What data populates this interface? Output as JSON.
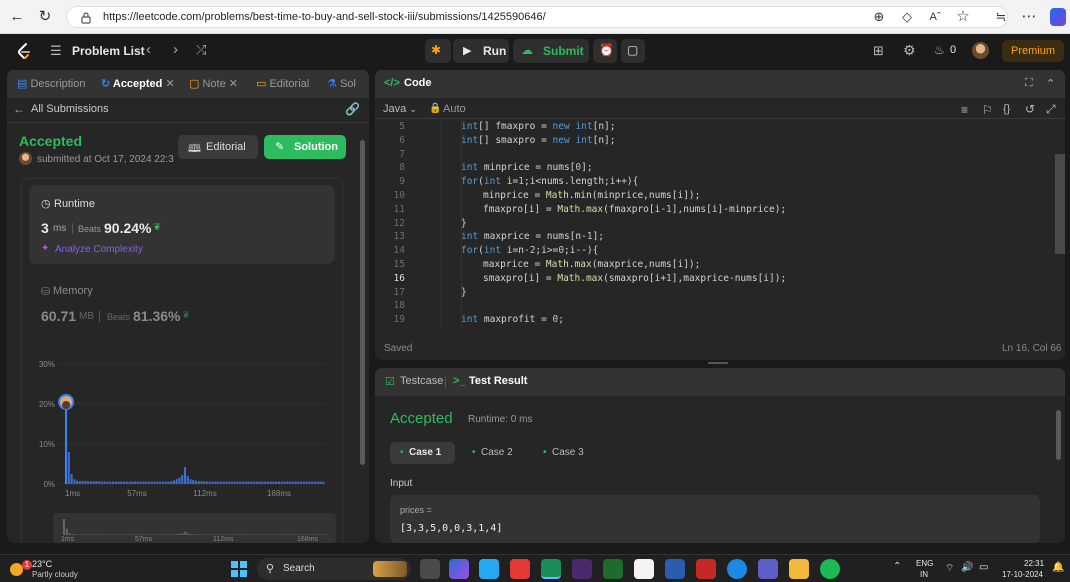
{
  "browser": {
    "url": "https://leetcode.com/problems/best-time-to-buy-and-sell-stock-iii/submissions/1425590646/",
    "reader_label": "Aˆ"
  },
  "topbar": {
    "problem_list": "Problem List",
    "run": "Run",
    "submit": "Submit",
    "streak": "0",
    "premium": "Premium"
  },
  "left": {
    "tabs": [
      "Description",
      "Accepted",
      "Note",
      "Editorial",
      "Sol"
    ],
    "all_submissions": "All Submissions",
    "status": "Accepted",
    "submitted": "submitted at Oct 17, 2024 22:3",
    "editorial_btn": "Editorial",
    "solution_btn": "Solution",
    "runtime_label": "Runtime",
    "runtime_value": "3",
    "runtime_unit": "ms",
    "beats_label": "Beats",
    "runtime_beats": "90.24%",
    "analyze": "Analyze Complexity",
    "memory_label": "Memory",
    "memory_value": "60.71",
    "memory_unit": "MB",
    "memory_beats": "81.36%"
  },
  "chart_data": {
    "type": "bar",
    "y_ticks": [
      "30%",
      "20%",
      "10%",
      "0%"
    ],
    "x_ticks": [
      "1ms",
      "57ms",
      "112ms",
      "168ms"
    ],
    "ylim": [
      0,
      30
    ],
    "values": [
      20.5,
      8,
      2.5,
      1.2,
      0.8,
      0.7,
      0.8,
      0.7,
      0.7,
      0.7,
      0.7,
      0.7,
      0.7,
      0.6,
      0.6,
      0.6,
      0.6,
      0.6,
      0.6,
      0.6,
      0.6,
      0.6,
      0.6,
      0.6,
      0.6,
      0.6,
      0.6,
      0.6,
      0.6,
      0.6,
      0.6,
      0.6,
      0.6,
      0.6,
      0.6,
      0.6,
      0.6,
      0.6,
      0.7,
      0.9,
      1.2,
      1.6,
      2.2,
      4.2,
      2.0,
      1.2,
      1.0,
      0.8,
      0.7,
      0.7,
      0.7,
      0.6,
      0.6,
      0.6,
      0.6,
      0.6,
      0.6,
      0.6,
      0.6,
      0.6,
      0.6,
      0.6,
      0.6,
      0.6,
      0.6,
      0.6,
      0.6,
      0.6,
      0.6,
      0.6,
      0.6,
      0.6,
      0.6,
      0.6,
      0.6,
      0.6,
      0.6,
      0.6,
      0.6,
      0.6,
      0.6,
      0.6,
      0.6,
      0.6,
      0.6,
      0.6,
      0.6,
      0.6,
      0.6,
      0.6,
      0.6,
      0.6,
      0.6,
      0.6
    ],
    "highlight_index": 0,
    "mini_x_ticks": [
      "1ms",
      "57ms",
      "112ms",
      "168ms"
    ]
  },
  "code": {
    "title": "Code",
    "language": "Java",
    "mode": "Auto",
    "saved": "Saved",
    "cursor": "Ln 16, Col 66",
    "lines": [
      {
        "n": "5",
        "indent": 0,
        "text": "int[] fmaxpro = new int[n];"
      },
      {
        "n": "6",
        "indent": 0,
        "text": "int[] smaxpro = new int[n];"
      },
      {
        "n": "7",
        "indent": 0,
        "text": ""
      },
      {
        "n": "8",
        "indent": 0,
        "text": "int minprice = nums[0];"
      },
      {
        "n": "9",
        "indent": 0,
        "text": "for(int i=1;i<nums.length;i++){"
      },
      {
        "n": "10",
        "indent": 1,
        "text": "minprice = Math.min(minprice,nums[i]);"
      },
      {
        "n": "11",
        "indent": 1,
        "text": "fmaxpro[i] = Math.max(fmaxpro[i-1],nums[i]-minprice);"
      },
      {
        "n": "12",
        "indent": 0,
        "text": "}"
      },
      {
        "n": "13",
        "indent": 0,
        "text": "int maxprice = nums[n-1];"
      },
      {
        "n": "14",
        "indent": 0,
        "text": "for(int i=n-2;i>=0;i--){"
      },
      {
        "n": "15",
        "indent": 1,
        "text": "maxprice = Math.max(maxprice,nums[i]);"
      },
      {
        "n": "16",
        "indent": 1,
        "text": "smaxpro[i] = Math.max(smaxpro[i+1],maxprice-nums[i]);"
      },
      {
        "n": "17",
        "indent": 0,
        "text": "}"
      },
      {
        "n": "18",
        "indent": 0,
        "text": ""
      },
      {
        "n": "19",
        "indent": 0,
        "text": "int maxprofit = 0;"
      }
    ]
  },
  "result": {
    "tab_testcase": "Testcase",
    "tab_result": "Test Result",
    "status": "Accepted",
    "runtime": "Runtime: 0 ms",
    "cases": [
      "Case 1",
      "Case 2",
      "Case 3"
    ],
    "input_label": "Input",
    "param_name": "prices =",
    "param_value": "[3,3,5,0,0,3,1,4]"
  },
  "taskbar": {
    "temp": "23°C",
    "weather": "Partly cloudy",
    "search": "Search",
    "lang1": "ENG",
    "lang2": "IN",
    "time": "22:31",
    "date": "17-10-2024",
    "badge": "1"
  },
  "colors": {
    "accent_green": "#2cbb5d",
    "premium": "#ffa116",
    "blue": "#0a84ff"
  }
}
